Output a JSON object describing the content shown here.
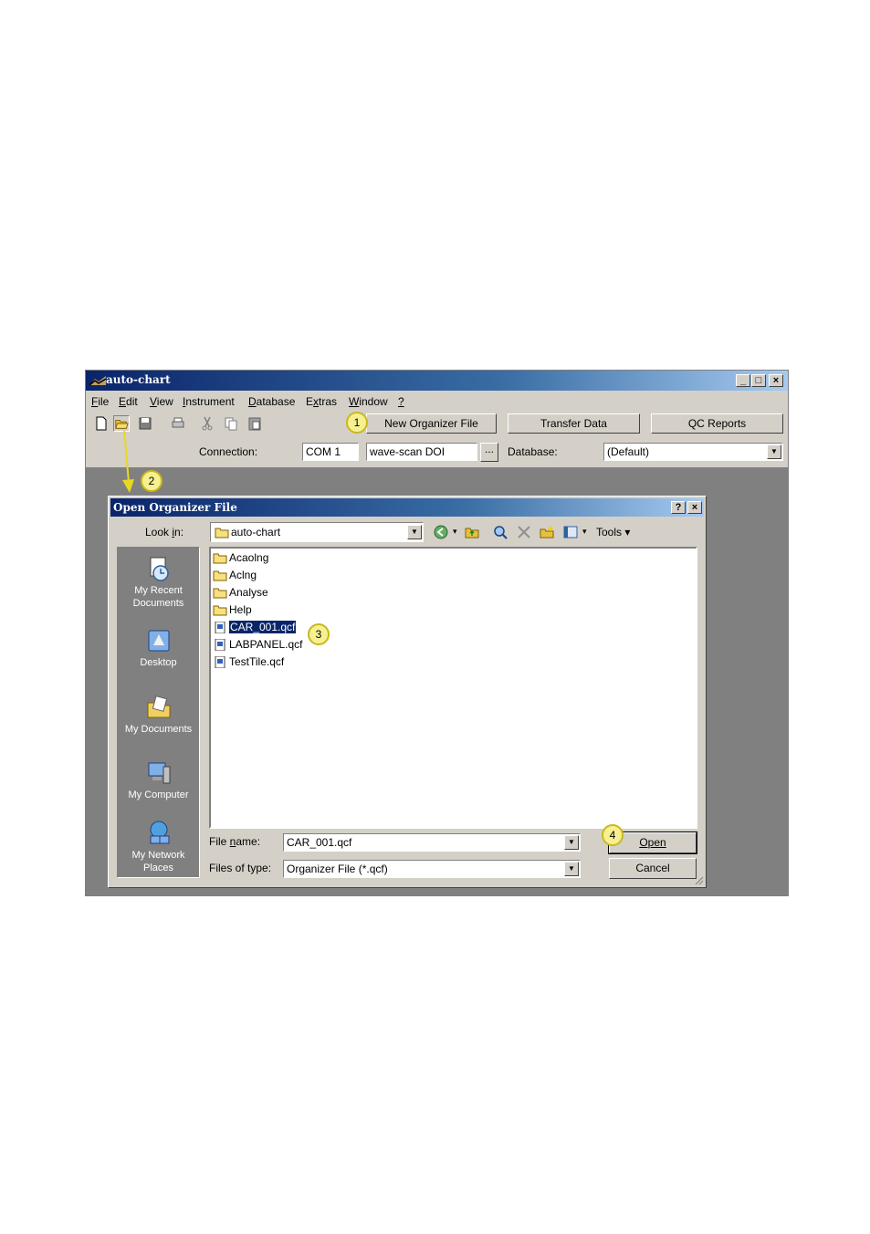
{
  "app": {
    "title": "auto-chart",
    "window_controls": {
      "minimize": "_",
      "maximize": "□",
      "close": "×"
    }
  },
  "menu": {
    "items": [
      {
        "label": "File",
        "ul": "F",
        "rest": "ile"
      },
      {
        "label": "Edit",
        "ul": "E",
        "rest": "dit"
      },
      {
        "label": "View",
        "ul": "V",
        "rest": "iew"
      },
      {
        "label": "Instrument",
        "ul": "I",
        "rest": "nstrument"
      },
      {
        "label": "Database",
        "ul": "D",
        "rest": "atabase"
      },
      {
        "label": "Extras",
        "pre": "E",
        "ul": "x",
        "rest": "tras"
      },
      {
        "label": "Window",
        "ul": "W",
        "rest": "indow"
      },
      {
        "label": "?",
        "ul": "?",
        "rest": ""
      }
    ]
  },
  "toolbar": {
    "icons": [
      "new-file-icon",
      "open-folder-icon",
      "save-icon",
      "print-icon",
      "cut-icon",
      "copy-icon",
      "paste-icon"
    ],
    "new_organizer_file": "New Organizer File",
    "transfer_data": "Transfer Data",
    "qc_reports": "QC Reports"
  },
  "connection": {
    "label": "Connection:",
    "port": "COM 1",
    "device": "wave-scan DOI",
    "browse": "...",
    "database_label": "Database:",
    "database_value": "(Default)"
  },
  "callouts": [
    "1",
    "2",
    "3",
    "4"
  ],
  "dialog": {
    "title": "Open Organizer File",
    "help": "?",
    "close": "×",
    "look_in_label": "Look in:",
    "look_in_ul": "i",
    "look_in_value": "auto-chart",
    "tools_label": "Tools",
    "places": [
      {
        "label": "My Recent Documents",
        "icon": "recent-documents-icon"
      },
      {
        "label": "Desktop",
        "icon": "desktop-icon"
      },
      {
        "label": "My Documents",
        "icon": "my-documents-icon"
      },
      {
        "label": "My Computer",
        "icon": "my-computer-icon"
      },
      {
        "label": "My Network Places",
        "icon": "network-places-icon"
      }
    ],
    "files": [
      {
        "name": "Acaolng",
        "type": "folder"
      },
      {
        "name": "Aclng",
        "type": "folder"
      },
      {
        "name": "Analyse",
        "type": "folder"
      },
      {
        "name": "Help",
        "type": "folder"
      },
      {
        "name": "CAR_001.qcf",
        "type": "file",
        "selected": true
      },
      {
        "name": "LABPANEL.qcf",
        "type": "file"
      },
      {
        "name": "TestTile.qcf",
        "type": "file"
      }
    ],
    "file_name_label": "File name:",
    "file_name_value": "CAR_001.qcf",
    "file_type_label": "Files of type:",
    "file_type_value": "Organizer File (*.qcf)",
    "open_button": "Open",
    "cancel_button": "Cancel"
  },
  "colors": {
    "titlebar": "#0a246a",
    "face": "#d4d0c8",
    "workspace": "#808080",
    "callout_fill": "#f7f090",
    "arrow": "#e8d820"
  }
}
